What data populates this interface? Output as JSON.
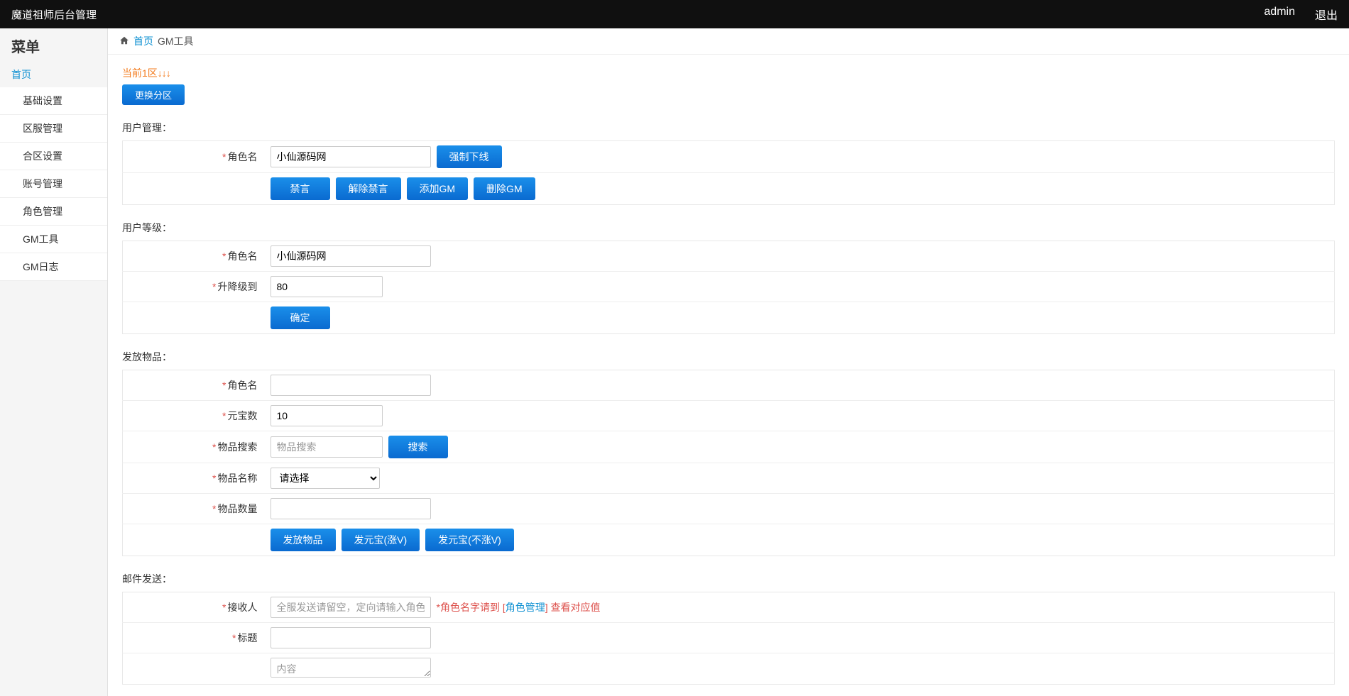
{
  "header": {
    "brand": "魔道祖师后台管理",
    "user": "admin",
    "logout": "退出"
  },
  "sidebar": {
    "menu_title": "菜单",
    "home": "首页",
    "items": [
      "基础设置",
      "区服管理",
      "合区设置",
      "账号管理",
      "角色管理",
      "GM工具",
      "GM日志"
    ]
  },
  "breadcrumb": {
    "home": "首页",
    "current": "GM工具"
  },
  "zone": {
    "current": "当前1区",
    "arrows": "↓↓↓",
    "change_btn": "更换分区"
  },
  "sections": {
    "user_manage": {
      "title": "用户管理：",
      "role_label": "角色名",
      "role_value": "小仙源码网",
      "force_offline": "强制下线",
      "ban": "禁言",
      "unban": "解除禁言",
      "add_gm": "添加GM",
      "del_gm": "删除GM"
    },
    "user_level": {
      "title": "用户等级：",
      "role_label": "角色名",
      "role_value": "小仙源码网",
      "level_label": "升降级到",
      "level_value": "80",
      "confirm": "确定"
    },
    "send_item": {
      "title": "发放物品：",
      "role_label": "角色名",
      "role_value": "",
      "yuanbao_label": "元宝数",
      "yuanbao_value": "10",
      "search_label": "物品搜索",
      "search_placeholder": "物品搜索",
      "search_btn": "搜索",
      "item_name_label": "物品名称",
      "item_name_option": "请选择",
      "item_qty_label": "物品数量",
      "item_qty_value": "",
      "send_item_btn": "发放物品",
      "send_yb_v": "发元宝(涨V)",
      "send_yb_nov": "发元宝(不涨V)"
    },
    "mail": {
      "title": "邮件发送：",
      "recipient_label": "接收人",
      "recipient_placeholder": "全服发送请留空，定向请输入角色名字",
      "recipient_hint_prefix": "*角色名字请到 [",
      "recipient_hint_link": "角色管理",
      "recipient_hint_suffix": "] 查看对应值",
      "title_label": "标题",
      "title_value": "",
      "content_label": "",
      "content_placeholder": "内容"
    }
  }
}
